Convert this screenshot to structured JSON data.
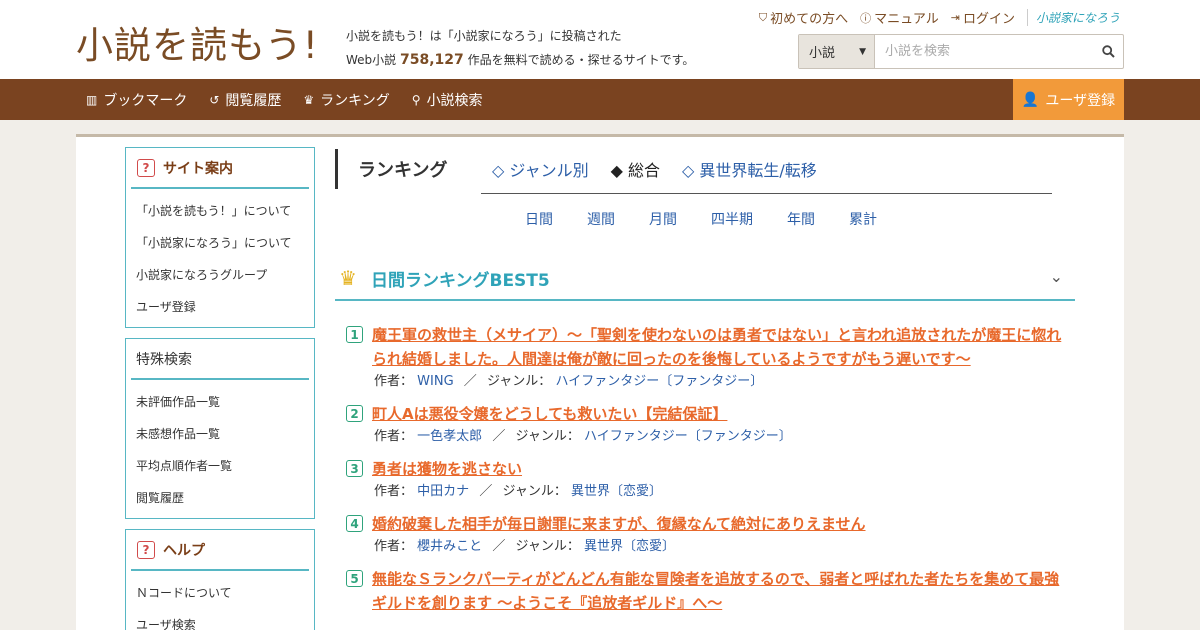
{
  "header": {
    "logo_text": "小説を読もう!",
    "tagline_line1": "小説を読もう！は「小説家になろう」に投稿された",
    "tagline_prefix": "Web小説",
    "novel_count": "758,127",
    "tagline_suffix": "作品を無料で読める・探せるサイトです。",
    "links": {
      "beginners": "初めての方へ",
      "manual": "マニュアル",
      "login": "ログイン",
      "brand": "小説家になろう"
    },
    "search": {
      "category": "小説",
      "placeholder": "小説を検索"
    }
  },
  "nav": {
    "bookmark": "ブックマーク",
    "history": "閲覧履歴",
    "ranking": "ランキング",
    "search": "小説検索",
    "register": "ユーザ登録"
  },
  "sidebar": {
    "guide": {
      "title": "サイト案内",
      "items": [
        "「小説を読もう！」について",
        "「小説家になろう」について",
        "小説家になろうグループ",
        "ユーザ登録"
      ]
    },
    "special": {
      "title": "特殊検索",
      "items": [
        "未評価作品一覧",
        "未感想作品一覧",
        "平均点順作者一覧",
        "閲覧履歴"
      ]
    },
    "help": {
      "title": "ヘルプ",
      "items": [
        "Ｎコードについて",
        "ユーザ検索"
      ]
    }
  },
  "ranking": {
    "title": "ランキング",
    "tabs": [
      "◇ ジャンル別",
      "◆ 総合",
      "◇ 異世界転生/転移"
    ],
    "periods": [
      "日間",
      "週間",
      "月間",
      "四半期",
      "年間",
      "累計"
    ],
    "section_title": "日間ランキングBEST5",
    "author_label": "作者：",
    "genre_label": "ジャンル：",
    "items": [
      {
        "rank": "1",
        "title": "魔王軍の救世主（メサイア）～「聖剣を使わないのは勇者ではない」と言われ追放されたが魔王に惚れられ結婚しました。人間達は俺が敵に回ったのを後悔しているようですがもう遅いです～",
        "author": "WING",
        "genre": "ハイファンタジー〔ファンタジー〕"
      },
      {
        "rank": "2",
        "title": "町人Aは悪役令嬢をどうしても救いたい【完結保証】",
        "author": "一色孝太郎",
        "genre": "ハイファンタジー〔ファンタジー〕"
      },
      {
        "rank": "3",
        "title": "勇者は獲物を逃さない",
        "author": "中田カナ",
        "genre": "異世界〔恋愛〕"
      },
      {
        "rank": "4",
        "title": "婚約破棄した相手が毎日謝罪に来ますが、復縁なんて絶対にありえません",
        "author": "櫻井みこと",
        "genre": "異世界〔恋愛〕"
      },
      {
        "rank": "5",
        "title": "無能なＳランクパーティがどんどん有能な冒険者を追放するので、弱者と呼ばれた者たちを集めて最強ギルドを創ります ～ようこそ『追放者ギルド』へ～",
        "author": "",
        "genre": ""
      }
    ]
  }
}
